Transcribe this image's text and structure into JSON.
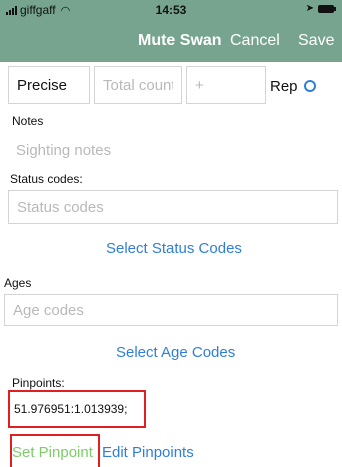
{
  "status_bar": {
    "carrier": "giffgaff",
    "time": "14:53"
  },
  "nav": {
    "title": "Mute Swan",
    "cancel": "Cancel",
    "save": "Save"
  },
  "count_row": {
    "precise": "Precise",
    "total_placeholder": "Total count",
    "plus_placeholder": "+",
    "rep_label": "Rep"
  },
  "notes": {
    "label": "Notes",
    "placeholder": "Sighting notes"
  },
  "status_codes": {
    "label": "Status codes:",
    "placeholder": "Status codes",
    "select_link": "Select Status Codes"
  },
  "ages": {
    "label": "Ages",
    "placeholder": "Age codes",
    "select_link": "Select Age Codes"
  },
  "pinpoints": {
    "label": "Pinpoints:",
    "value": "51.976951:1.013939;",
    "set_link": "Set Pinpoint",
    "edit_link": "Edit Pinpoints"
  },
  "colors": {
    "header": "#76a48f",
    "link": "#2f7fd6",
    "set_link": "#7ecb6a",
    "highlight": "#e02020"
  }
}
